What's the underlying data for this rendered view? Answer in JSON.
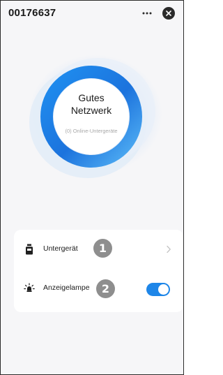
{
  "header": {
    "title": "00176637",
    "more_icon": "more-horizontal-icon",
    "close_icon": "close-circle-icon"
  },
  "status": {
    "line1": "Gutes",
    "line2": "Netzwerk",
    "subtitle": "(0) Online-Untergeräte",
    "ring_color": "#1e86e8"
  },
  "settings": {
    "sub_device": {
      "icon": "sub-device-icon",
      "label": "Untergerät",
      "badge": "1",
      "chevron_icon": "chevron-right-icon"
    },
    "indicator_lamp": {
      "icon": "lamp-icon",
      "label": "Anzeigelampe",
      "badge": "2",
      "toggle_on": true,
      "toggle_color": "#1e86e8"
    }
  }
}
